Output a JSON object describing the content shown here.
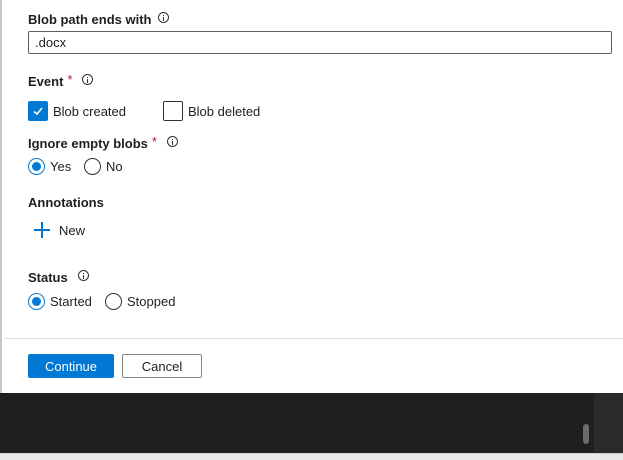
{
  "blob_path": {
    "label": "Blob path ends with",
    "value": ".docx"
  },
  "event": {
    "label": "Event",
    "required_mark": "*",
    "options": [
      {
        "label": "Blob created",
        "checked": true
      },
      {
        "label": "Blob deleted",
        "checked": false
      }
    ]
  },
  "ignore_empty": {
    "label": "Ignore empty blobs",
    "required_mark": "*",
    "options": [
      {
        "label": "Yes",
        "selected": true
      },
      {
        "label": "No",
        "selected": false
      }
    ]
  },
  "annotations": {
    "label": "Annotations",
    "new_label": "New"
  },
  "status": {
    "label": "Status",
    "options": [
      {
        "label": "Started",
        "selected": true
      },
      {
        "label": "Stopped",
        "selected": false
      }
    ]
  },
  "footer": {
    "continue_label": "Continue",
    "cancel_label": "Cancel"
  },
  "colors": {
    "accent": "#0078d4",
    "required": "#a4262c"
  }
}
